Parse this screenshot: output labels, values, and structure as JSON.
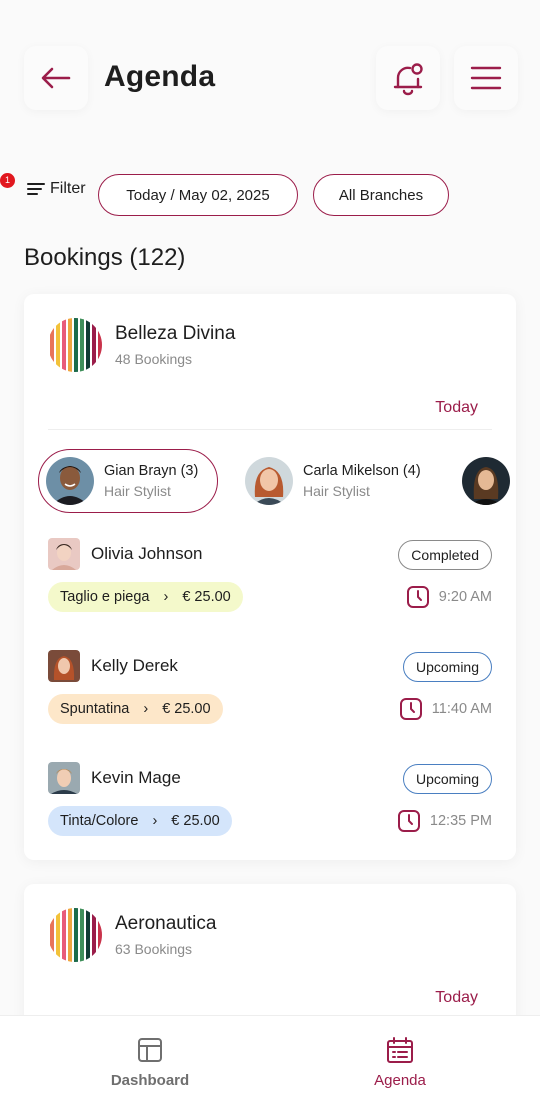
{
  "header": {
    "title": "Agenda",
    "icons": {
      "back": "arrow-left-icon",
      "notifications": "bell-icon",
      "menu": "hamburger-menu-icon"
    }
  },
  "filters": {
    "filter_label": "Filter",
    "filter_count": "1",
    "date_label": "Today / May 02, 2025",
    "branch_label": "All Branches"
  },
  "bookings_title": "Bookings (122)",
  "branches": [
    {
      "name": "Belleza Divina",
      "count": "48 Bookings",
      "date_link": "Today",
      "staff": [
        {
          "name": "Gian Brayn (3)",
          "role": "Hair Stylist",
          "active": true
        },
        {
          "name": "Carla Mikelson (4)",
          "role": "Hair Stylist",
          "active": false
        },
        {
          "name": "",
          "role": "",
          "active": false
        }
      ],
      "bookings": [
        {
          "client": "Olivia Johnson",
          "status": "Completed",
          "service": "Taglio e piega",
          "price": "€ 25.00",
          "time": "9:20 AM",
          "service_color": "#f4f9cb"
        },
        {
          "client": "Kelly Derek",
          "status": "Upcoming",
          "service": "Spuntatina",
          "price": "€ 25.00",
          "time": "11:40 AM",
          "service_color": "#fde7c9"
        },
        {
          "client": "Kevin Mage",
          "status": "Upcoming",
          "service": "Tinta/Colore",
          "price": "€ 25.00",
          "time": "12:35 PM",
          "service_color": "#d4e5fb"
        }
      ]
    },
    {
      "name": "Aeronautica",
      "count": "63 Bookings",
      "date_link": "Today"
    }
  ],
  "bottom_nav": {
    "dashboard_label": "Dashboard",
    "agenda_label": "Agenda",
    "active": "Agenda"
  },
  "colors": {
    "accent": "#9b1d4a",
    "badge": "#e1171e",
    "upcoming_border": "#4a7fc1",
    "muted_text": "#8a8a8a"
  }
}
